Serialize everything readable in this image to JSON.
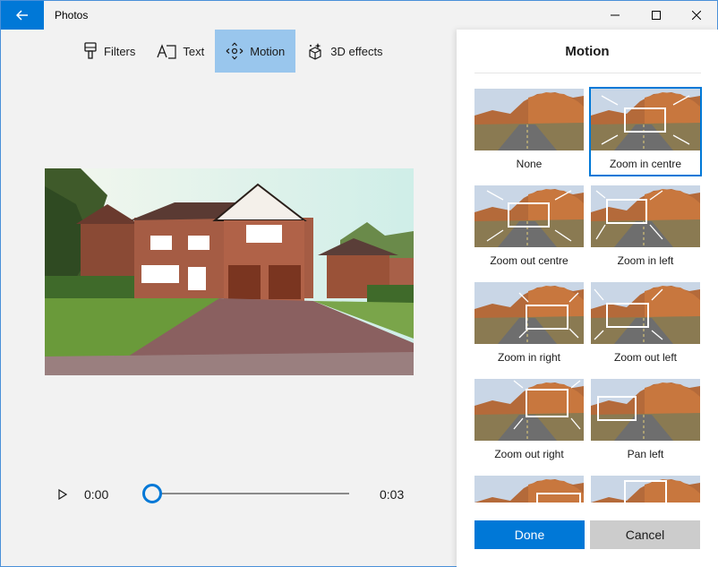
{
  "window": {
    "title": "Photos",
    "accent": "#0078d7"
  },
  "toolbar": {
    "items": [
      {
        "label": "Filters",
        "icon": "paintbrush-icon",
        "active": false
      },
      {
        "label": "Text",
        "icon": "text-icon",
        "active": false
      },
      {
        "label": "Motion",
        "icon": "motion-icon",
        "active": true
      },
      {
        "label": "3D effects",
        "icon": "3d-effects-icon",
        "active": false
      }
    ]
  },
  "player": {
    "current_time": "0:00",
    "end_time": "0:03",
    "progress": 0
  },
  "panel": {
    "title": "Motion",
    "options": [
      {
        "label": "None",
        "selected": false
      },
      {
        "label": "Zoom in centre",
        "selected": true
      },
      {
        "label": "Zoom out centre",
        "selected": false
      },
      {
        "label": "Zoom in left",
        "selected": false
      },
      {
        "label": "Zoom in right",
        "selected": false
      },
      {
        "label": "Zoom out left",
        "selected": false
      },
      {
        "label": "Zoom out right",
        "selected": false
      },
      {
        "label": "Pan left",
        "selected": false
      }
    ],
    "done_label": "Done",
    "cancel_label": "Cancel"
  }
}
